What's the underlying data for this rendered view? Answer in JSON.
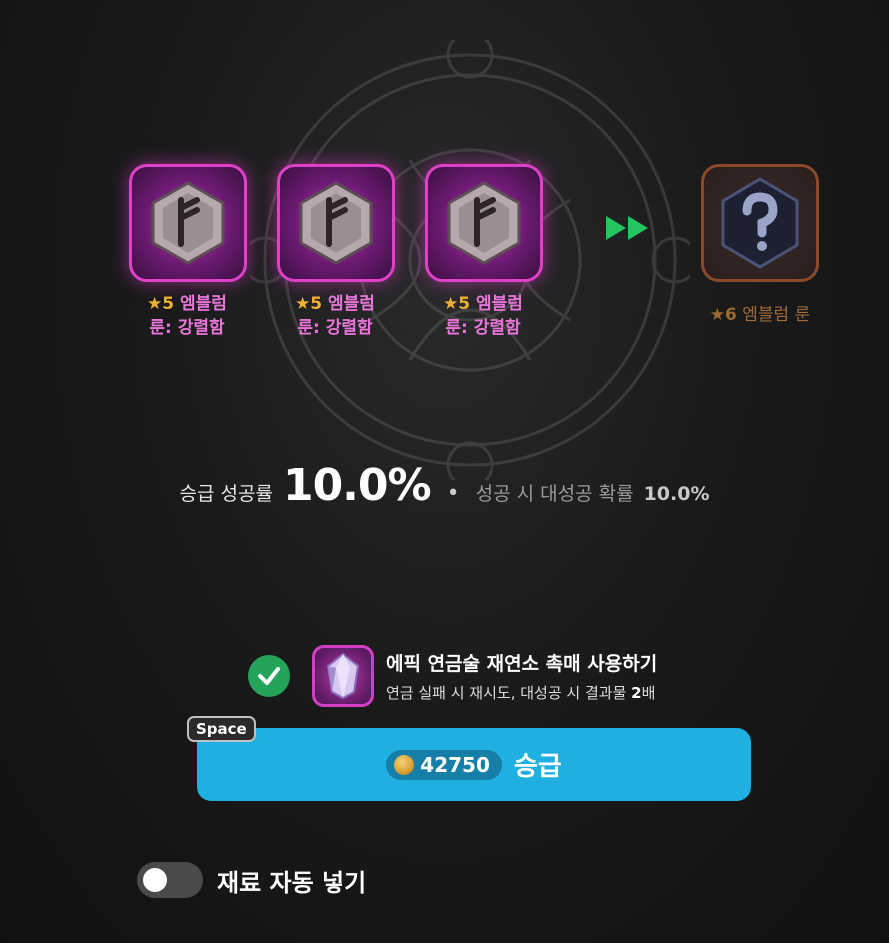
{
  "slots": [
    {
      "star_text": "★5",
      "name_line1": "엠블럼",
      "name_line2": "룬: 강렬함",
      "icon": "rune-icon"
    },
    {
      "star_text": "★5",
      "name_line1": "엠블럼",
      "name_line2": "룬: 강렬함",
      "icon": "rune-icon"
    },
    {
      "star_text": "★5",
      "name_line1": "엠블럼",
      "name_line2": "룬: 강렬함",
      "icon": "rune-icon"
    }
  ],
  "result": {
    "star_text": "★6",
    "name": "엠블럼 룬",
    "icon": "question-icon"
  },
  "rates": {
    "success_label": "승급 성공률",
    "success_value": "10.0%",
    "separator": "•",
    "crit_label": "성공 시 대성공 확률",
    "crit_value": "10.0%"
  },
  "catalyst": {
    "checked": true,
    "title": "에픽 연금술 재연소 촉매 사용하기",
    "desc_prefix": "연금 실패 시 재시도, 대성공 시 결과물 ",
    "desc_bold": "2",
    "desc_suffix": "배"
  },
  "upgrade": {
    "hotkey": "Space",
    "cost": "42750",
    "label": "승급"
  },
  "auto_fill": {
    "enabled": false,
    "label": "재료 자동 넣기"
  },
  "colors": {
    "button": "#1fafe0",
    "epic_border": "#e040c8",
    "check": "#24a35a"
  }
}
